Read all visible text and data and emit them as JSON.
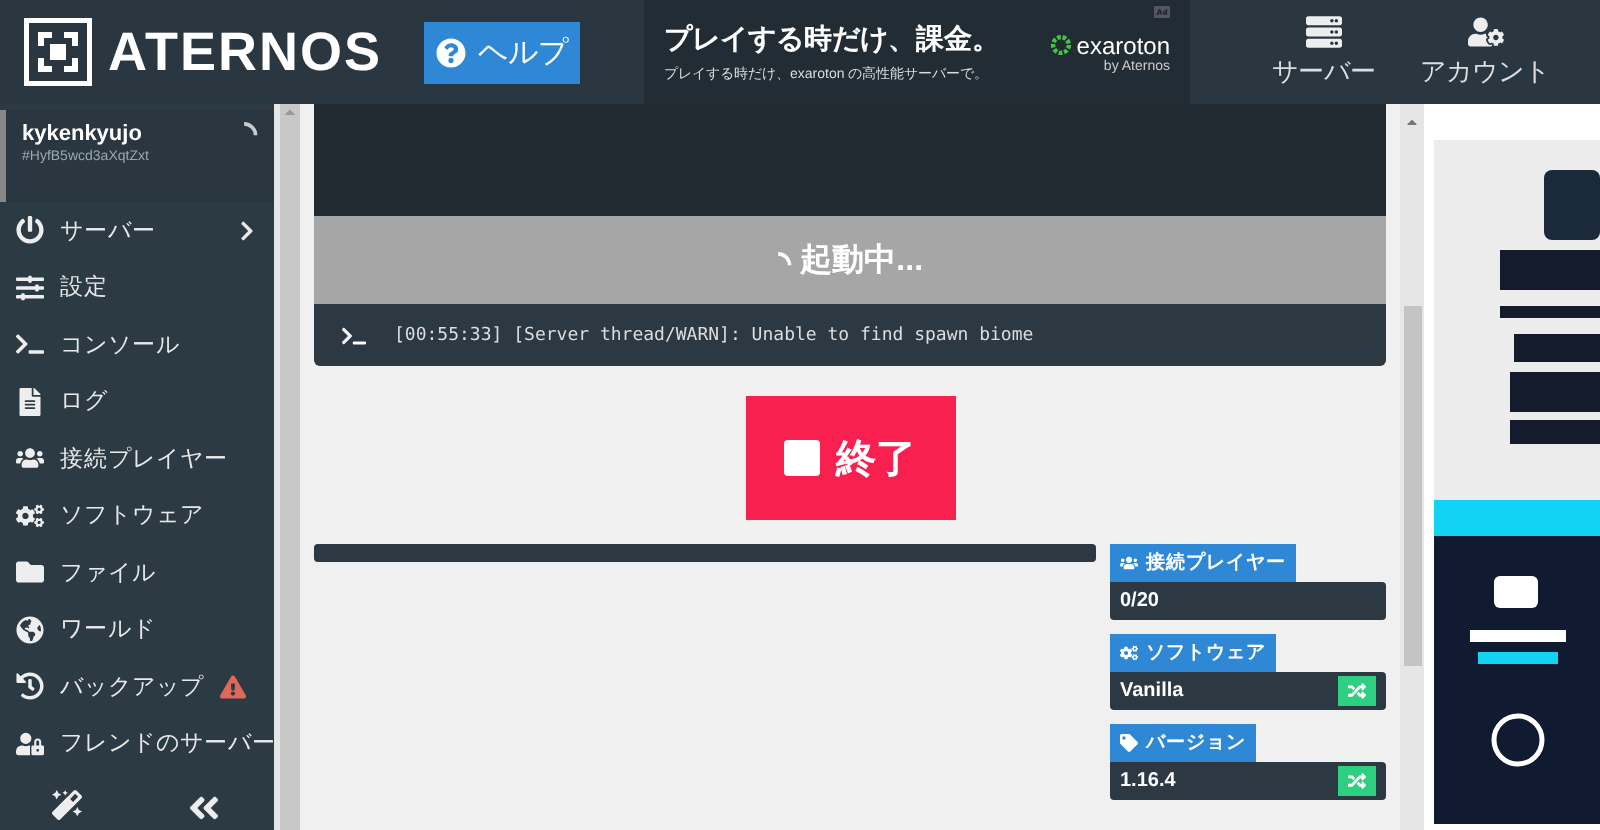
{
  "header": {
    "logo": "ATERNOS",
    "help_button": "ヘルプ",
    "ad": {
      "headline": "プレイする時だけ、課金。",
      "subline": "プレイする時だけ、exaroton の高性能サーバーで。",
      "brand": "exaroton",
      "brand_sub": "by Aternos"
    },
    "nav": [
      {
        "label": "サーバー"
      },
      {
        "label": "アカウント"
      }
    ]
  },
  "sidebar": {
    "user": {
      "name": "kykenkyujo",
      "id": "#HyfB5wcd3aXqtZxt"
    },
    "items": [
      {
        "label": "サーバー",
        "kind": "submenu"
      },
      {
        "label": "設定",
        "kind": "plain"
      },
      {
        "label": "コンソール",
        "kind": "plain"
      },
      {
        "label": "ログ",
        "kind": "plain"
      },
      {
        "label": "接続プレイヤー",
        "kind": "plain"
      },
      {
        "label": "ソフトウェア",
        "kind": "plain"
      },
      {
        "label": "ファイル",
        "kind": "plain"
      },
      {
        "label": "ワールド",
        "kind": "plain"
      },
      {
        "label": "バックアップ",
        "kind": "warning"
      },
      {
        "label": "フレンドのサーバー",
        "kind": "plain"
      }
    ]
  },
  "server": {
    "status": "起動中...",
    "console_line": "[00:55:33] [Server thread/WARN]: Unable to find spawn biome",
    "stop_button": "終了",
    "progress": {
      "level": 1
    },
    "info": [
      {
        "label": "接続プレイヤー",
        "value": "0/20",
        "switchable": false
      },
      {
        "label": "ソフトウェア",
        "value": "Vanilla",
        "switchable": true
      },
      {
        "label": "バージョン",
        "value": "1.16.4",
        "switchable": true
      }
    ]
  }
}
